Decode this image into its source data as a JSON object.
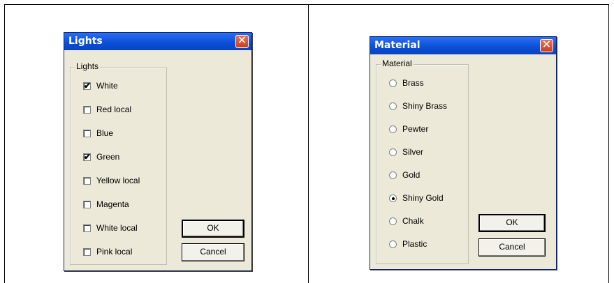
{
  "lights_dialog": {
    "title": "Lights",
    "group_label": "Lights",
    "items": [
      {
        "label": "White",
        "checked": true
      },
      {
        "label": "Red local",
        "checked": false
      },
      {
        "label": "Blue",
        "checked": false
      },
      {
        "label": "Green",
        "checked": true
      },
      {
        "label": "Yellow local",
        "checked": false
      },
      {
        "label": "Magenta",
        "checked": false
      },
      {
        "label": "White local",
        "checked": false
      },
      {
        "label": "Pink local",
        "checked": false
      }
    ],
    "ok_label": "OK",
    "cancel_label": "Cancel"
  },
  "material_dialog": {
    "title": "Material",
    "group_label": "Material",
    "items": [
      {
        "label": "Brass",
        "selected": false
      },
      {
        "label": "Shiny Brass",
        "selected": false
      },
      {
        "label": "Pewter",
        "selected": false
      },
      {
        "label": "Silver",
        "selected": false
      },
      {
        "label": "Gold",
        "selected": false
      },
      {
        "label": "Shiny Gold",
        "selected": true
      },
      {
        "label": "Chalk",
        "selected": false
      },
      {
        "label": "Plastic",
        "selected": false
      }
    ],
    "ok_label": "OK",
    "cancel_label": "Cancel"
  },
  "close_glyph": "✕",
  "check_glyph": "✔"
}
